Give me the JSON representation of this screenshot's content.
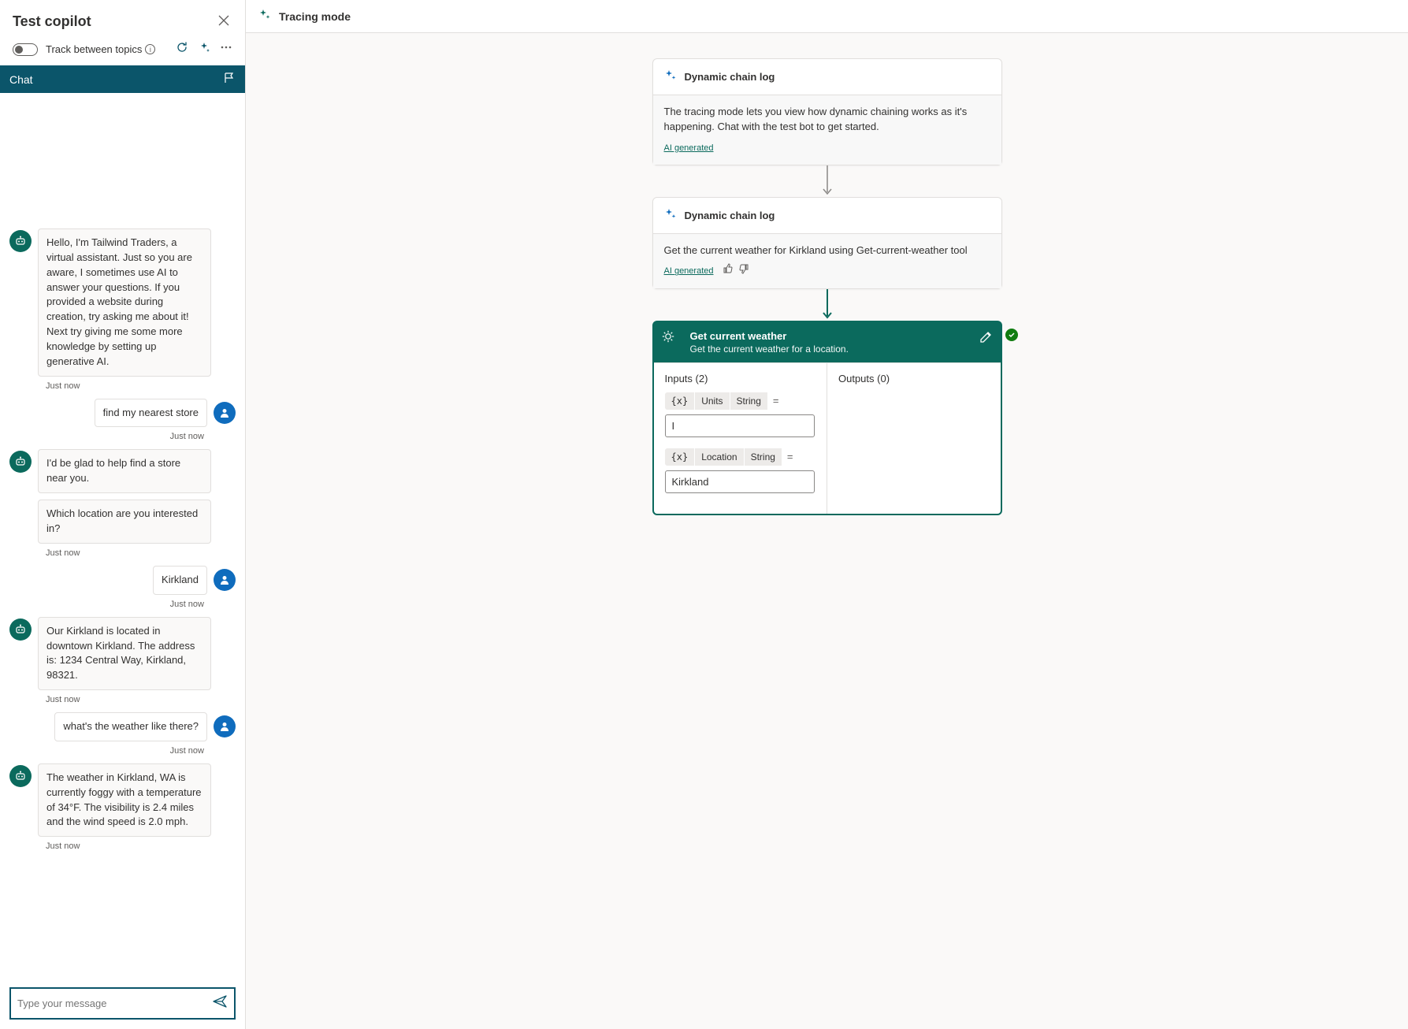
{
  "leftPanel": {
    "title": "Test copilot",
    "trackLabel": "Track between topics",
    "chatHeader": "Chat",
    "inputPlaceholder": "Type your message",
    "messages": [
      {
        "role": "bot",
        "text": "Hello, I'm Tailwind Traders, a virtual assistant. Just so you are aware, I sometimes use AI to answer your questions. If you provided a website during creation, try asking me about it! Next try giving me some more knowledge by setting up generative AI.",
        "ts": "Just now"
      },
      {
        "role": "user",
        "text": "find my nearest store",
        "ts": "Just now"
      },
      {
        "role": "bot",
        "text": "I'd be glad to help find a store near you.",
        "ts": ""
      },
      {
        "role": "bot",
        "text": "Which location are you interested in?",
        "ts": "Just now"
      },
      {
        "role": "user",
        "text": "Kirkland",
        "ts": "Just now"
      },
      {
        "role": "bot",
        "text": "Our Kirkland is located in downtown Kirkland. The address is: 1234 Central Way, Kirkland, 98321.",
        "ts": "Just now"
      },
      {
        "role": "user",
        "text": "what's the weather like there?",
        "ts": "Just now"
      },
      {
        "role": "bot",
        "text": "The weather in Kirkland, WA is currently foggy with a temperature of 34°F. The visibility is 2.4 miles and the wind speed is 2.0 mph.",
        "ts": "Just now"
      }
    ]
  },
  "rightPanel": {
    "title": "Tracing mode",
    "node1": {
      "title": "Dynamic chain log",
      "body": "The tracing mode lets you view how dynamic chaining works as it's happening. Chat with the test bot to get started.",
      "aiGen": "AI generated"
    },
    "node2": {
      "title": "Dynamic chain log",
      "body": "Get the current weather for Kirkland using Get-current-weather tool",
      "aiGen": "AI generated"
    },
    "tool": {
      "title": "Get current weather",
      "subtitle": "Get the current weather for a location.",
      "inputsLabel": "Inputs (2)",
      "outputsLabel": "Outputs (0)",
      "param1": {
        "var": "{x}",
        "name": "Units",
        "type": "String",
        "value": "I"
      },
      "param2": {
        "var": "{x}",
        "name": "Location",
        "type": "String",
        "value": "Kirkland"
      }
    }
  }
}
